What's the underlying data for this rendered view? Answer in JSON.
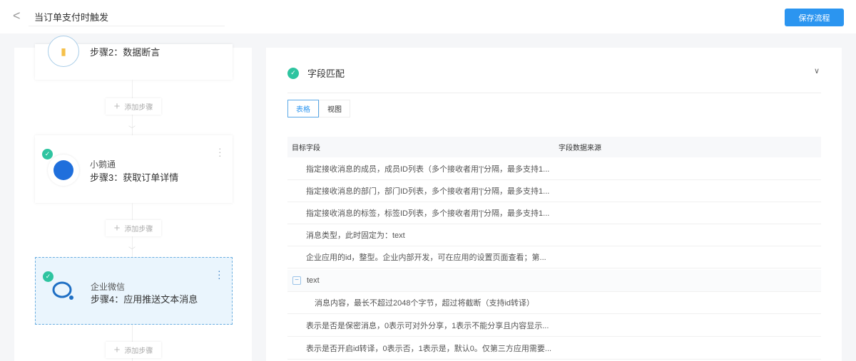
{
  "header": {
    "title": "当订单支付时触发",
    "save_label": "保存流程"
  },
  "steps": [
    {
      "app": "",
      "label": "步骤2：数据断言"
    },
    {
      "app": "小鹅通",
      "label": "步骤3：获取订单详情"
    },
    {
      "app": "企业微信",
      "label": "步骤4：应用推送文本消息"
    }
  ],
  "add_step_label": "添加步骤",
  "panel": {
    "title": "字段匹配",
    "tabs": [
      "表格",
      "视图"
    ],
    "columns": [
      "目标字段",
      "字段数据来源"
    ],
    "rows": [
      "指定接收消息的成员，成员ID列表（多个接收者用'|'分隔，最多支持1...",
      "指定接收消息的部门，部门ID列表，多个接收者用'|'分隔，最多支持1...",
      "指定接收消息的标签，标签ID列表，多个接收者用'|'分隔，最多支持1...",
      "消息类型，此时固定为：text",
      "企业应用的id，整型。企业内部开发，可在应用的设置页面查看；第...",
      "text",
      "消息内容，最长不超过2048个字节，超过将截断（支持id转译）",
      "表示是否是保密消息，0表示可对外分享，1表示不能分享且内容显示...",
      "表示是否开启id转译，0表示否，1表示是，默认0。仅第三方应用需要..."
    ]
  },
  "colors": {
    "accent": "#2b95f0",
    "success": "#2ec4a0"
  }
}
